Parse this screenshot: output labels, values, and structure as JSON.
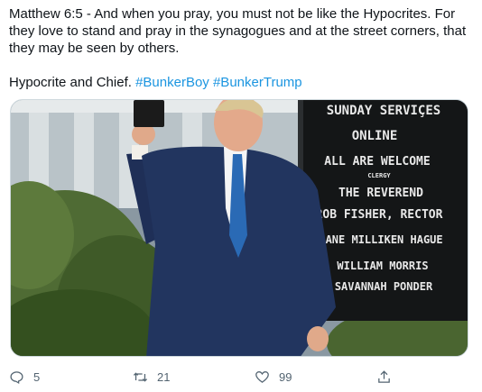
{
  "tweet": {
    "paragraph_1": "Matthew 6:5 - And when you pray, you must not be like the Hypocrites. For they love to stand and pray in the synagogues and at the street corners, that they may be seen by others.",
    "paragraph_2_text": "Hypocrite and Chief. ",
    "hashtags": [
      "#BunkerBoy",
      "#BunkerTrump"
    ]
  },
  "photo_sign": {
    "lines": [
      "SUNDAY SERVIÇES",
      "ONLINE",
      "ALL ARE WELCOME",
      "CLERGY",
      "THE REVEREND",
      "ROB FISHER, RECTOR",
      "JANE MILLIKEN HAGUE",
      "WILLIAM MORRIS",
      "SAVANNAH PONDER"
    ]
  },
  "actions": {
    "reply": {
      "icon": "reply-icon",
      "count": "5"
    },
    "retweet": {
      "icon": "retweet-icon",
      "count": "21"
    },
    "like": {
      "icon": "heart-icon",
      "count": "99"
    },
    "share": {
      "icon": "share-icon"
    }
  },
  "colors": {
    "hashtag": "#1b95e0",
    "action_gray": "#536471",
    "text": "#0f1419"
  }
}
